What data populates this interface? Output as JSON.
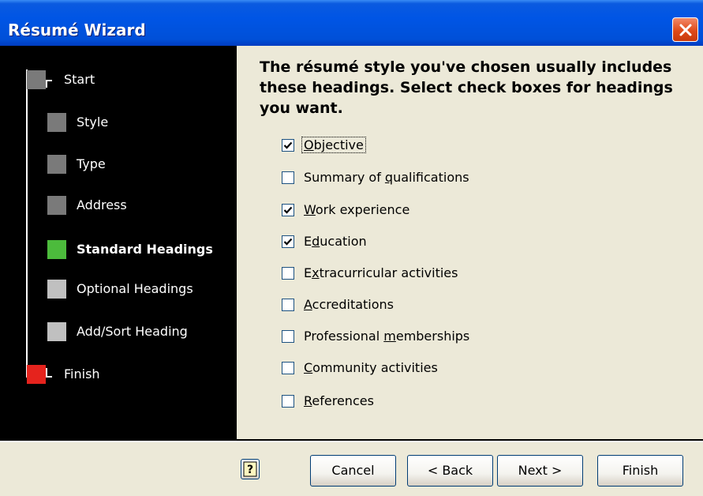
{
  "window": {
    "title": "Résumé Wizard"
  },
  "steps": [
    {
      "label": "Start",
      "state": "done",
      "color": "#7a7a7a"
    },
    {
      "label": "Style",
      "state": "done",
      "color": "#7a7a7a"
    },
    {
      "label": "Type",
      "state": "done",
      "color": "#7a7a7a"
    },
    {
      "label": "Address",
      "state": "done",
      "color": "#7a7a7a"
    },
    {
      "label": "Standard Headings",
      "state": "current",
      "color": "#4cbb3c"
    },
    {
      "label": "Optional Headings",
      "state": "pending",
      "color": "#c0c0c0"
    },
    {
      "label": "Add/Sort Heading",
      "state": "pending",
      "color": "#c0c0c0"
    },
    {
      "label": "Finish",
      "state": "end",
      "color": "#e5231d"
    }
  ],
  "content": {
    "instructions": "The résumé style you've chosen usually includes these headings.  Select check boxes for headings you want."
  },
  "headings": [
    {
      "label": "Objective",
      "checked": true,
      "focused": true,
      "accel": "O"
    },
    {
      "label": "Summary of qualifications",
      "checked": false,
      "accel": "q"
    },
    {
      "label": "Work experience",
      "checked": true,
      "accel": "W"
    },
    {
      "label": "Education",
      "checked": true,
      "accel": "d"
    },
    {
      "label": "Extracurricular activities",
      "checked": false,
      "accel": "x"
    },
    {
      "label": "Accreditations",
      "checked": false,
      "accel": "A"
    },
    {
      "label": "Professional memberships",
      "checked": false,
      "accel": "m"
    },
    {
      "label": "Community activities",
      "checked": false,
      "accel": "C"
    },
    {
      "label": "References",
      "checked": false,
      "accel": "R"
    }
  ],
  "buttons": {
    "help_icon": "help-icon",
    "cancel": "Cancel",
    "back": "< Back",
    "next": "Next >",
    "finish": "Finish"
  },
  "colors": {
    "titlebar": "#0055e5",
    "close": "#df4a1a",
    "panel": "#000000",
    "face": "#ece9d8"
  }
}
